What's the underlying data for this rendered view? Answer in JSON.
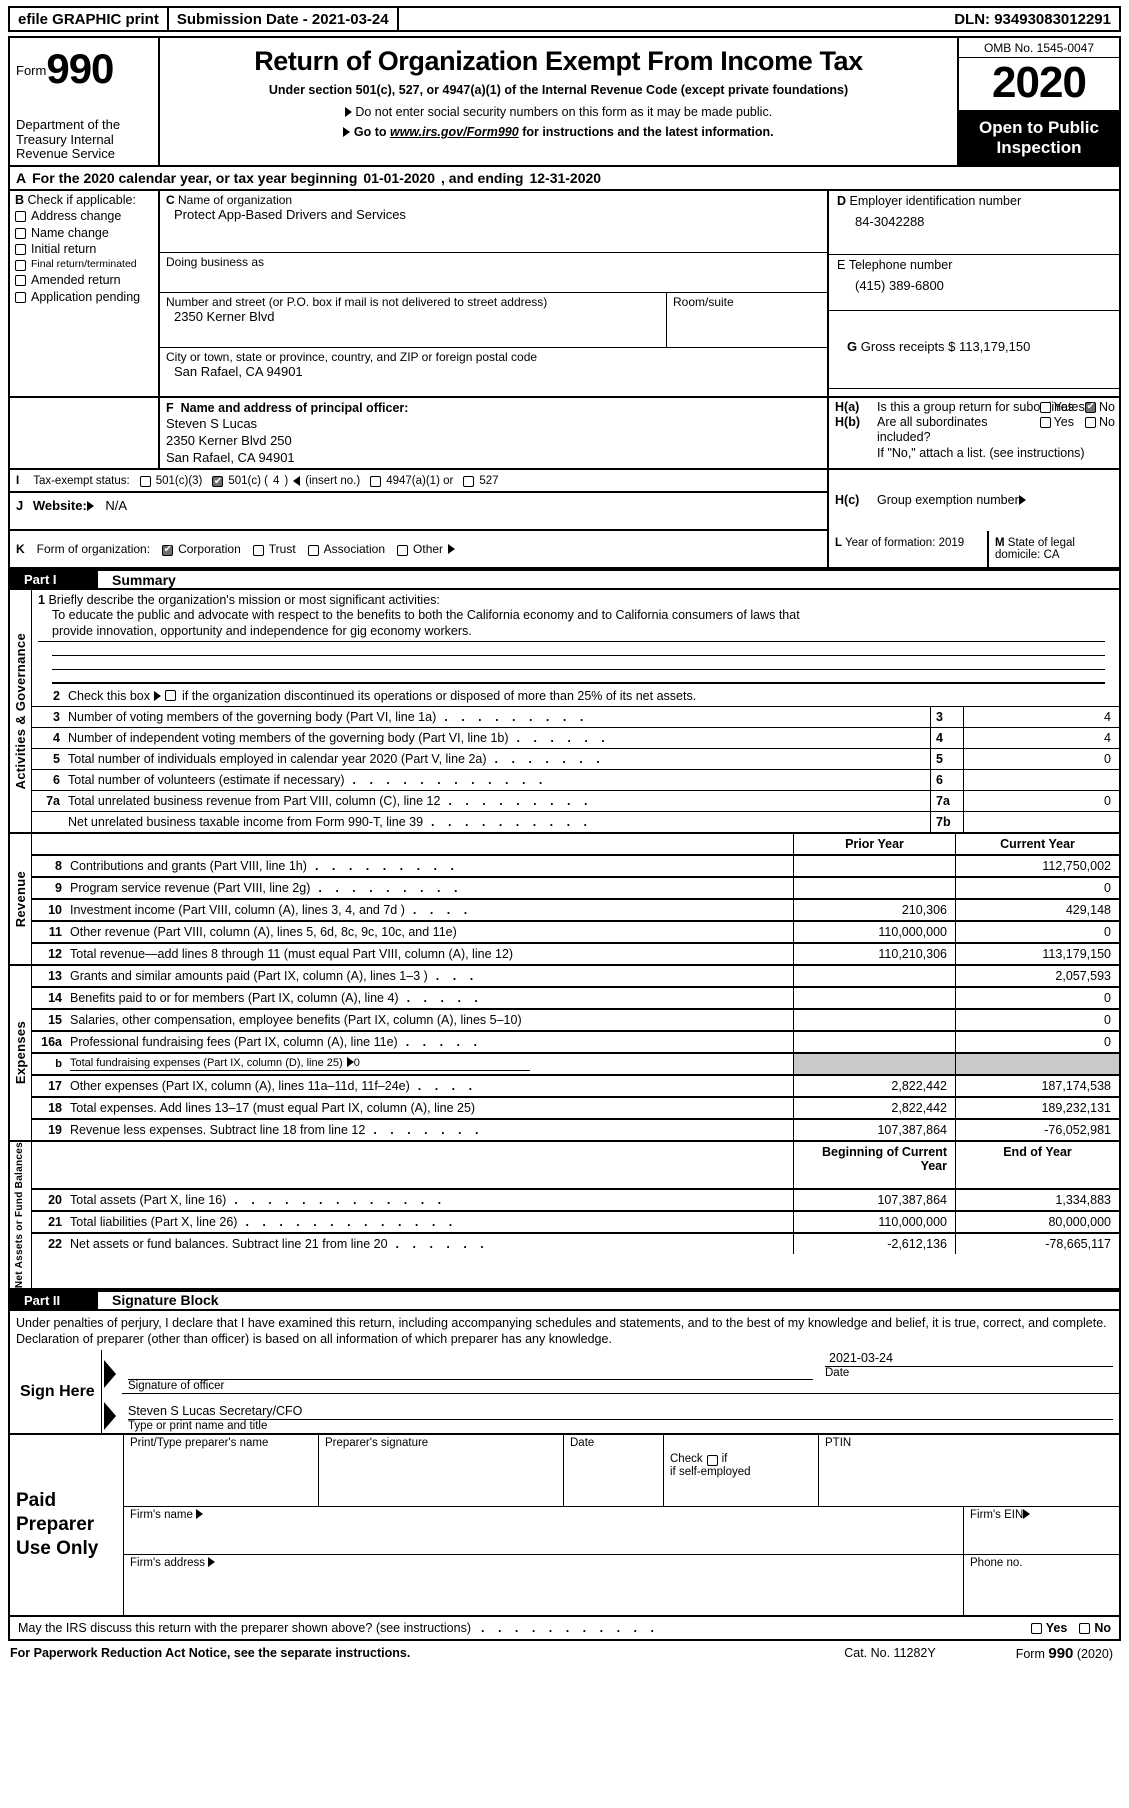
{
  "efile": {
    "left": "efile GRAPHIC print",
    "middle": "Submission Date - 2021-03-24",
    "right": "DLN: 93493083012291"
  },
  "masthead": {
    "form_label": "Form",
    "form_number": "990",
    "department": "Department of the Treasury Internal Revenue Service",
    "title": "Return of Organization Exempt From Income Tax",
    "subtitle": "Under section 501(c), 527, or 4947(a)(1) of the Internal Revenue Code (except private foundations)",
    "bullet1": "Do not enter social security numbers on this form as it may be made public.",
    "bullet2_prefix": "Go to ",
    "bullet2_link": "www.irs.gov/Form990",
    "bullet2_suffix": " for instructions and the latest information.",
    "omb": "OMB No. 1545-0047",
    "year": "2020",
    "open_to_public": "Open to Public Inspection"
  },
  "rowA": {
    "letter": "A",
    "text_before": "For the 2020 calendar year, or tax year beginning",
    "begin_date": "01-01-2020",
    "text_middle": ", and ending",
    "end_date": "12-31-2020"
  },
  "checkB": {
    "letter": "B",
    "heading": "Check if applicable:",
    "items": [
      {
        "label": "Address change",
        "checked": false
      },
      {
        "label": "Name change",
        "checked": false
      },
      {
        "label": "Initial return",
        "checked": false
      },
      {
        "label": "Final return/terminated",
        "checked": false
      },
      {
        "label": "Amended return",
        "checked": false
      },
      {
        "label": "Application pending",
        "checked": false
      }
    ]
  },
  "orgC": {
    "letter": "C",
    "name_label": "Name of organization",
    "name_value": "Protect App-Based Drivers and Services",
    "dba_label": "Doing business as",
    "dba_value": "",
    "street_label": "Number and street (or P.O. box if mail is not delivered to street address)",
    "street_value": "2350 Kerner Blvd",
    "room_label": "Room/suite",
    "room_value": "",
    "city_label": "City or town, state or province, country, and ZIP or foreign postal code",
    "city_value": "San Rafael, CA  94901"
  },
  "blockD": {
    "letter": "D",
    "label": "Employer identification number",
    "value": "84-3042288"
  },
  "blockE": {
    "letter": "E",
    "label": "Telephone number",
    "value": "(415) 389-6800"
  },
  "blockG": {
    "letter": "G",
    "label": "Gross receipts $",
    "value": "113,179,150"
  },
  "blockF": {
    "letter": "F",
    "label": "Name and address of principal officer:",
    "line1": "Steven S Lucas",
    "line2": "2350 Kerner Blvd 250",
    "line3": "San Rafael, CA  94901"
  },
  "blockH": {
    "a_key": "H(a)",
    "a_text": "Is this a group return for subordinates?",
    "a_yes": "Yes",
    "a_no": "No",
    "a_yes_checked": false,
    "a_no_checked": true,
    "b_key": "H(b)",
    "b_text": "Are all subordinates included?",
    "b_yes": "Yes",
    "b_no": "No",
    "b_yes_checked": false,
    "b_no_checked": false,
    "b_note": "If \"No,\" attach a list. (see instructions)",
    "c_key": "H(c)",
    "c_text": "Group exemption number",
    "c_value": ""
  },
  "blockI": {
    "letter": "I",
    "label": "Tax-exempt status:",
    "opt1": "501(c)(3)",
    "opt1_checked": false,
    "opt2_pre": "501(c) (",
    "opt2_num": "4",
    "opt2_post": ")",
    "opt2_note": "(insert no.)",
    "opt2_checked": true,
    "opt3": "4947(a)(1) or",
    "opt3_checked": false,
    "opt4": "527",
    "opt4_checked": false
  },
  "blockJ": {
    "letter": "J",
    "label": "Website:",
    "value": "N/A"
  },
  "blockK": {
    "letter": "K",
    "label": "Form of organization:",
    "opt1": "Corporation",
    "opt1_checked": true,
    "opt2": "Trust",
    "opt2_checked": false,
    "opt3": "Association",
    "opt3_checked": false,
    "opt4": "Other",
    "opt4_checked": false
  },
  "blockL": {
    "letter": "L",
    "label": "Year of formation:",
    "value": "2019"
  },
  "blockM": {
    "letter": "M",
    "label": "State of legal domicile:",
    "value": "CA"
  },
  "partI": {
    "part_label": "Part I",
    "title": "Summary",
    "vtab_activities": "Activities & Governance",
    "vtab_revenue": "Revenue",
    "vtab_expenses": "Expenses",
    "vtab_netassets": "Net Assets or Fund Balances",
    "line1_num": "1",
    "line1_label": "Briefly describe the organization's mission or most significant activities:",
    "mission_line1": "To educate the public and advocate with respect to the benefits to both the California economy and to California consumers of laws that",
    "mission_line2": "provide innovation, opportunity and independence for gig economy workers.",
    "line2_num": "2",
    "line2_text": "Check this box",
    "line2_text2": "if the organization discontinued its operations or disposed of more than 25% of its net assets.",
    "line2_checked": false,
    "gov_rows": [
      {
        "num": "3",
        "text": "Number of voting members of the governing body (Part VI, line 1a)",
        "dots": ". . . . . . . . .",
        "key": "3",
        "value": "4"
      },
      {
        "num": "4",
        "text": "Number of independent voting members of the governing body (Part VI, line 1b)",
        "dots": ". . . . . .",
        "key": "4",
        "value": "4"
      },
      {
        "num": "5",
        "text": "Total number of individuals employed in calendar year 2020 (Part V, line 2a)",
        "dots": ". . . . . . .",
        "key": "5",
        "value": "0"
      },
      {
        "num": "6",
        "text": "Total number of volunteers (estimate if necessary)",
        "dots": ". . . . . . . . . . . .",
        "key": "6",
        "value": ""
      },
      {
        "num": "7a",
        "text": "Total unrelated business revenue from Part VIII, column (C), line 12",
        "dots": ". . . . . . . . .",
        "key": "7a",
        "value": "0"
      },
      {
        "num": "",
        "text": "Net unrelated business taxable income from Form 990-T, line 39",
        "dots": ". . . . . . . . . .",
        "key": "7b",
        "value": ""
      }
    ],
    "rev_header_prior": "Prior Year",
    "rev_header_current": "Current Year",
    "revenue_rows": [
      {
        "num": "8",
        "text": "Contributions and grants (Part VIII, line 1h)",
        "dots": ". . . . . . . . .",
        "prior": "",
        "current": "112,750,002"
      },
      {
        "num": "9",
        "text": "Program service revenue (Part VIII, line 2g)",
        "dots": ". . . . . . . . .",
        "prior": "",
        "current": "0"
      },
      {
        "num": "10",
        "text": "Investment income (Part VIII, column (A), lines 3, 4, and 7d )",
        "dots": ". . . .",
        "prior": "210,306",
        "current": "429,148"
      },
      {
        "num": "11",
        "text": "Other revenue (Part VIII, column (A), lines 5, 6d, 8c, 9c, 10c, and 11e)",
        "dots": "",
        "prior": "110,000,000",
        "current": "0"
      },
      {
        "num": "12",
        "text": "Total revenue—add lines 8 through 11 (must equal Part VIII, column (A), line 12)",
        "dots": "",
        "prior": "110,210,306",
        "current": "113,179,150"
      }
    ],
    "expense_rows": [
      {
        "num": "13",
        "text": "Grants and similar amounts paid (Part IX, column (A), lines 1–3 )",
        "dots": ". . .",
        "prior": "",
        "current": "2,057,593",
        "shaded": false
      },
      {
        "num": "14",
        "text": "Benefits paid to or for members (Part IX, column (A), line 4)",
        "dots": ". . . . .",
        "prior": "",
        "current": "0",
        "shaded": false
      },
      {
        "num": "15",
        "text": "Salaries, other compensation, employee benefits (Part IX, column (A), lines 5–10)",
        "dots": "",
        "prior": "",
        "current": "0",
        "shaded": false
      },
      {
        "num": "16a",
        "text": "Professional fundraising fees (Part IX, column (A), line 11e)",
        "dots": ". . . . .",
        "prior": "",
        "current": "0",
        "shaded": false
      },
      {
        "num": "b",
        "text": "Total fundraising expenses (Part IX, column (D), line 25)",
        "dots": "",
        "prior": "",
        "current": "",
        "shaded": true,
        "small": true,
        "arrow_value": "0"
      },
      {
        "num": "17",
        "text": "Other expenses (Part IX, column (A), lines 11a–11d, 11f–24e)",
        "dots": ". . . .",
        "prior": "2,822,442",
        "current": "187,174,538",
        "shaded": false
      },
      {
        "num": "18",
        "text": "Total expenses. Add lines 13–17 (must equal Part IX, column (A), line 25)",
        "dots": "",
        "prior": "2,822,442",
        "current": "189,232,131",
        "shaded": false
      },
      {
        "num": "19",
        "text": "Revenue less expenses. Subtract line 18 from line 12",
        "dots": ". . . . . . .",
        "prior": "107,387,864",
        "current": "-76,052,981",
        "shaded": false
      }
    ],
    "na_header_begin": "Beginning of Current Year",
    "na_header_end": "End of Year",
    "netassets_rows": [
      {
        "num": "20",
        "text": "Total assets (Part X, line 16)",
        "dots": ". . . . . . . . . . . . .",
        "begin": "107,387,864",
        "end": "1,334,883"
      },
      {
        "num": "21",
        "text": "Total liabilities (Part X, line 26)",
        "dots": ". . . . . . . . . . . . .",
        "begin": "110,000,000",
        "end": "80,000,000"
      },
      {
        "num": "22",
        "text": "Net assets or fund balances. Subtract line 21 from line 20",
        "dots": ". . . . . .",
        "begin": "-2,612,136",
        "end": "-78,665,117"
      }
    ]
  },
  "partII": {
    "part_label": "Part II",
    "title": "Signature Block",
    "perjury": "Under penalties of perjury, I declare that I have examined this return, including accompanying schedules and statements, and to the best of my knowledge and belief, it is true, correct, and complete. Declaration of preparer (other than officer) is based on all information of which preparer has any knowledge.",
    "sign_here": "Sign Here",
    "sig_officer_label": "Signature of officer",
    "sig_officer_value": "",
    "date_label": "Date",
    "date_value": "2021-03-24",
    "name_title_value": "Steven S Lucas  Secretary/CFO",
    "name_title_label": "Type or print name and title"
  },
  "preparer": {
    "heading": "Paid Preparer Use Only",
    "name_label": "Print/Type preparer's name",
    "name_value": "",
    "sig_label": "Preparer's signature",
    "sig_value": "",
    "date_label": "Date",
    "date_value": "",
    "check_label_1": "Check",
    "check_label_2": "if self-employed",
    "check_checked": false,
    "ptin_label": "PTIN",
    "ptin_value": "",
    "firm_name_label": "Firm's name",
    "firm_name_value": "",
    "firm_ein_label": "Firm's EIN",
    "firm_ein_value": "",
    "firm_addr_label": "Firm's address",
    "firm_addr_value": "",
    "phone_label": "Phone no.",
    "phone_value": ""
  },
  "irs_question": {
    "text": "May the IRS discuss this return with the preparer shown above? (see instructions)",
    "dots": ". . . . . . . . . . .",
    "yes": "Yes",
    "no": "No",
    "yes_checked": false,
    "no_checked": false
  },
  "footer": {
    "left": "For Paperwork Reduction Act Notice, see the separate instructions.",
    "center": "Cat. No. 11282Y",
    "right_pre": "Form ",
    "right_num": "990",
    "right_post": " (2020)"
  }
}
